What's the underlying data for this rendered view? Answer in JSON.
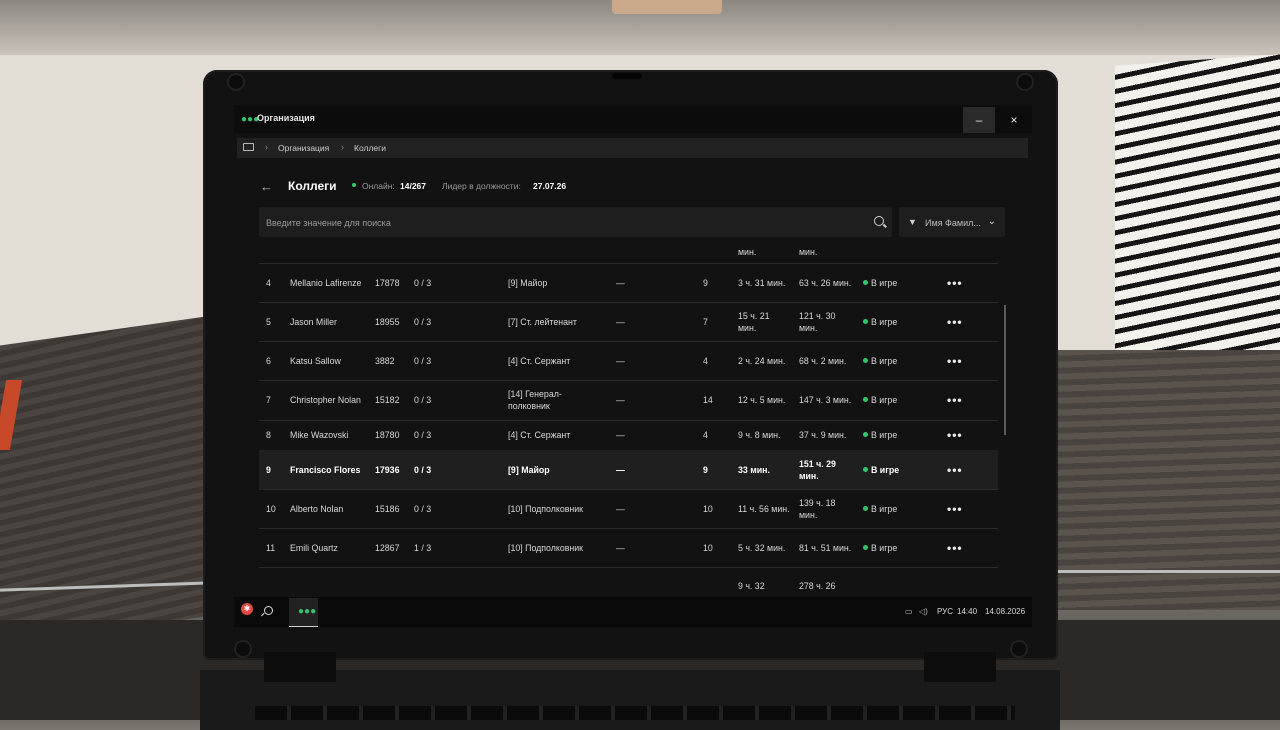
{
  "window": {
    "title": "Организация",
    "minimize_label": "–",
    "close_label": "×"
  },
  "breadcrumb": [
    "Организация",
    "Коллеги"
  ],
  "header": {
    "back_label": "←",
    "title": "Коллеги",
    "online_label": "Онлайн:",
    "online_value": "14/267",
    "leader_label": "Лидер в должности:",
    "leader_value": "27.07.26"
  },
  "search": {
    "placeholder": "Введите значение для поиска"
  },
  "filter": {
    "label": "Имя Фамил..."
  },
  "table": {
    "top_partial": [
      "мин.",
      "мин."
    ],
    "rows": [
      {
        "num": "4",
        "name": "Mellanio Lafirenze",
        "id": "17878",
        "warns": "0 / 3",
        "rank": "[9] Майор",
        "extra": "—",
        "level": "9",
        "today": "3 ч. 31 мин.",
        "week": "63 ч. 26 мин.",
        "status": "В игре",
        "highlight": false
      },
      {
        "num": "5",
        "name": "Jason Miller",
        "id": "18955",
        "warns": "0 / 3",
        "rank": "[7] Ст. лейтенант",
        "extra": "—",
        "level": "7",
        "today": "15 ч. 21 мин.",
        "week": "121 ч. 30 мин.",
        "status": "В игре",
        "highlight": false
      },
      {
        "num": "6",
        "name": "Katsu Sallow",
        "id": "3882",
        "warns": "0 / 3",
        "rank": "[4] Ст. Сержант",
        "extra": "—",
        "level": "4",
        "today": "2 ч. 24 мин.",
        "week": "68 ч. 2 мин.",
        "status": "В игре",
        "highlight": false
      },
      {
        "num": "7",
        "name": "Christopher Nolan",
        "id": "15182",
        "warns": "0 / 3",
        "rank": "[14] Генерал-полковник",
        "extra": "—",
        "level": "14",
        "today": "12 ч. 5 мин.",
        "week": "147 ч. 3 мин.",
        "status": "В игре",
        "highlight": false
      },
      {
        "num": "8",
        "name": "Mike Wazovski",
        "id": "18780",
        "warns": "0 / 3",
        "rank": "[4] Ст. Сержант",
        "extra": "—",
        "level": "4",
        "today": "9 ч. 8 мин.",
        "week": "37 ч. 9 мин.",
        "status": "В игре",
        "highlight": false
      },
      {
        "num": "9",
        "name": "Francisco Flores",
        "id": "17936",
        "warns": "0 / 3",
        "rank": "[9] Майор",
        "extra": "—",
        "level": "9",
        "today": "33 мин.",
        "week": "151 ч. 29 мин.",
        "status": "В игре",
        "highlight": true
      },
      {
        "num": "10",
        "name": "Alberto Nolan",
        "id": "15186",
        "warns": "0 / 3",
        "rank": "[10] Подполковник",
        "extra": "—",
        "level": "10",
        "today": "11 ч. 56 мин.",
        "week": "139 ч. 18 мин.",
        "status": "В игре",
        "highlight": false
      },
      {
        "num": "11",
        "name": "Emili Quartz",
        "id": "12867",
        "warns": "1 / 3",
        "rank": "[10] Подполковник",
        "extra": "—",
        "level": "10",
        "today": "5 ч. 32 мин.",
        "week": "81 ч. 51 мин.",
        "status": "В игре",
        "highlight": false
      }
    ],
    "bottom_partial": {
      "today": "9 ч. 32",
      "week": "278 ч. 26"
    },
    "more_label": "•••"
  },
  "taskbar": {
    "language": "РУС",
    "time": "14:40",
    "date": "14.08.2026"
  },
  "colors": {
    "accent_green": "#36c46a",
    "logo_red": "#e04a43"
  }
}
